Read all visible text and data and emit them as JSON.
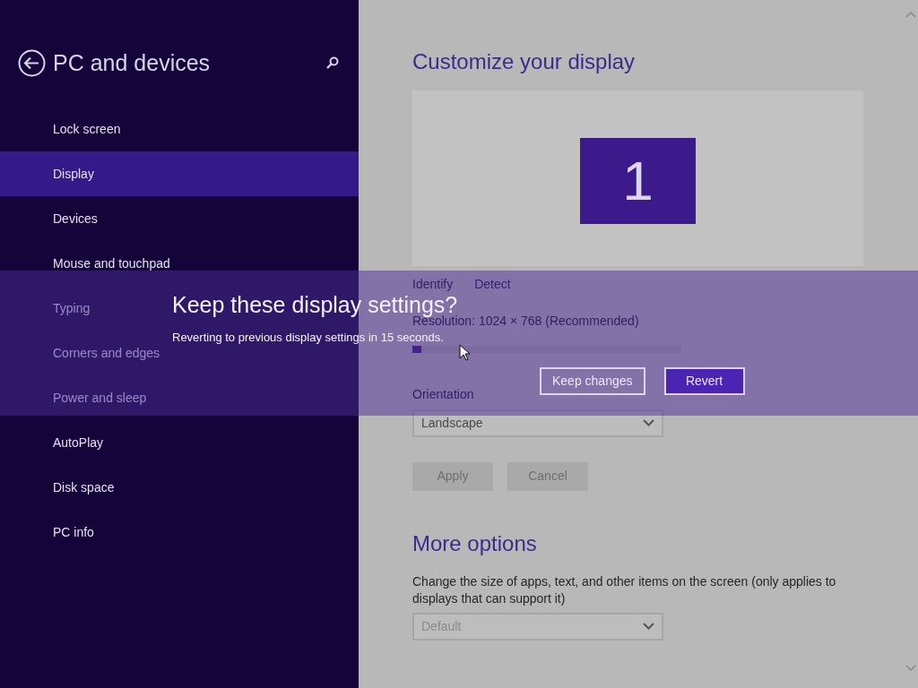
{
  "sidebar": {
    "title": "PC and devices",
    "items": [
      {
        "label": "Lock screen",
        "selected": false
      },
      {
        "label": "Display",
        "selected": true
      },
      {
        "label": "Devices",
        "selected": false
      },
      {
        "label": "Mouse and touchpad",
        "selected": false
      },
      {
        "label": "Typing",
        "selected": false
      },
      {
        "label": "Corners and edges",
        "selected": false
      },
      {
        "label": "Power and sleep",
        "selected": false
      },
      {
        "label": "AutoPlay",
        "selected": false
      },
      {
        "label": "Disk space",
        "selected": false
      },
      {
        "label": "PC info",
        "selected": false
      }
    ]
  },
  "main": {
    "title": "Customize your display",
    "monitor_label": "1",
    "links": [
      "Identify",
      "Detect"
    ],
    "resolution": {
      "label": "Resolution: 1024 × 768 (Recommended)",
      "level": 0.0
    },
    "orientation": {
      "label": "Orientation",
      "value": "Landscape"
    },
    "buttons": [
      "Apply",
      "Cancel"
    ],
    "more_options": {
      "title": "More options",
      "description": "Change the size of apps, text, and other items on the screen (only applies to displays that can support it)",
      "value": "Default"
    }
  },
  "dialog": {
    "title": "Keep these display settings?",
    "message": "Reverting to previous display settings in 15 seconds.",
    "buttons": [
      {
        "label": "Keep changes",
        "kind": "secondary"
      },
      {
        "label": "Revert",
        "kind": "primary"
      }
    ]
  }
}
